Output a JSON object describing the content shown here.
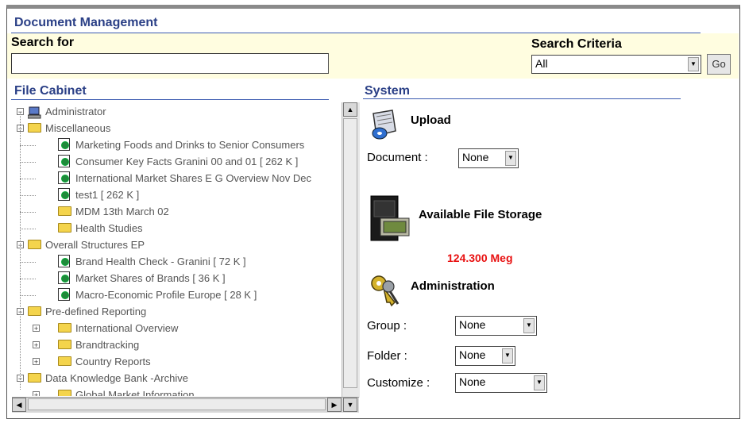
{
  "app": {
    "title": "Document Management"
  },
  "search": {
    "label": "Search for",
    "value": "",
    "criteria_label": "Search Criteria",
    "criteria_value": "All",
    "go_label": "Go"
  },
  "file_cabinet": {
    "title": "File Cabinet",
    "tree": [
      {
        "label": "Administrator",
        "kind": "admin",
        "level": 0,
        "expander": "−"
      },
      {
        "label": "Miscellaneous",
        "kind": "folder-open",
        "level": 0,
        "expander": "−"
      },
      {
        "label": "Marketing Foods and Drinks to Senior Consumers",
        "kind": "doc",
        "level": 1
      },
      {
        "label": "Consumer Key Facts Granini 00 and 01 [ 262 K ]",
        "kind": "doc",
        "level": 1
      },
      {
        "label": "International Market Shares E G  Overview Nov Dec",
        "kind": "doc",
        "level": 1
      },
      {
        "label": "test1 [ 262 K ]",
        "kind": "doc",
        "level": 1
      },
      {
        "label": "MDM 13th March 02",
        "kind": "folder",
        "level": 1
      },
      {
        "label": "Health Studies",
        "kind": "folder",
        "level": 1
      },
      {
        "label": "Overall Structures EP",
        "kind": "folder-open",
        "level": 0,
        "expander": "−"
      },
      {
        "label": "Brand Health Check - Granini [ 72 K ]",
        "kind": "doc",
        "level": 1
      },
      {
        "label": "Market Shares of Brands [ 36 K ]",
        "kind": "doc",
        "level": 1
      },
      {
        "label": "Macro-Economic Profile Europe [ 28 K ]",
        "kind": "doc",
        "level": 1
      },
      {
        "label": "Pre-defined Reporting",
        "kind": "folder-open",
        "level": 0,
        "expander": "−"
      },
      {
        "label": "International Overview",
        "kind": "folder",
        "level": 1,
        "expander": "+"
      },
      {
        "label": "Brandtracking",
        "kind": "folder",
        "level": 1,
        "expander": "+"
      },
      {
        "label": "Country Reports",
        "kind": "folder",
        "level": 1,
        "expander": "+"
      },
      {
        "label": "Data Knowledge Bank -Archive",
        "kind": "folder-open",
        "level": 0,
        "expander": "−"
      },
      {
        "label": "Global Market Information",
        "kind": "folder",
        "level": 1,
        "expander": "+"
      }
    ]
  },
  "system": {
    "title": "System",
    "upload": {
      "heading": "Upload",
      "document_label": "Document :",
      "document_value": "None"
    },
    "storage": {
      "heading": "Available File Storage",
      "value": "124.300 Meg"
    },
    "administration": {
      "heading": "Administration",
      "group_label": "Group :",
      "group_value": "None",
      "folder_label": "Folder :",
      "folder_value": "None",
      "customize_label": "Customize :",
      "customize_value": "None"
    }
  },
  "colors": {
    "accent": "#2a3f86",
    "search_bg": "#fffde0",
    "storage_value": "#e81010"
  },
  "icons": [
    "upload-icon",
    "file-storage-icon",
    "administration-keys-icon",
    "folder-icon",
    "document-icon",
    "administrator-icon"
  ]
}
